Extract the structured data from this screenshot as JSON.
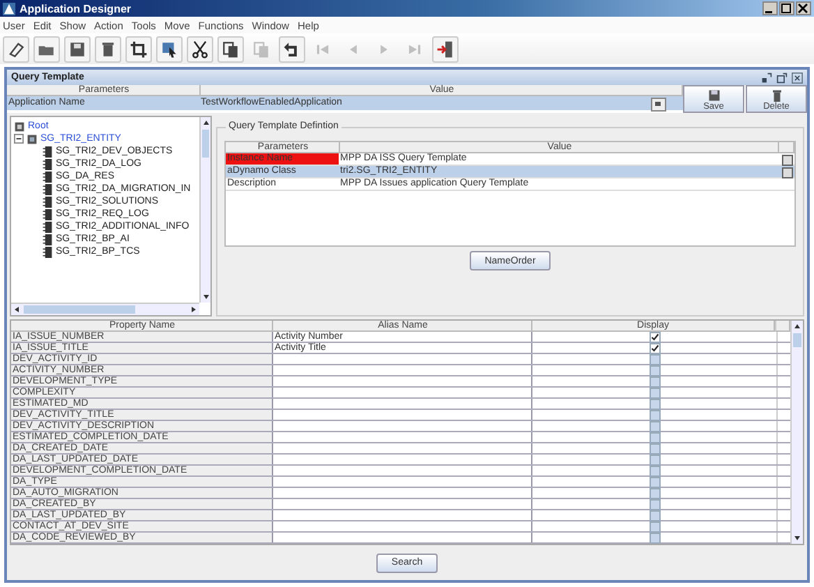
{
  "window": {
    "title": "Application Designer"
  },
  "menu": [
    "User",
    "Edit",
    "Show",
    "Action",
    "Tools",
    "Move",
    "Functions",
    "Window",
    "Help"
  ],
  "toolbar": [
    {
      "disabled": false
    },
    {
      "disabled": false
    },
    {
      "disabled": false
    },
    {
      "disabled": false
    },
    {
      "disabled": false
    },
    {
      "disabled": false
    },
    {
      "disabled": false
    },
    {
      "disabled": false
    },
    {
      "disabled": true
    },
    {
      "disabled": false
    },
    {
      "disabled": true
    },
    {
      "disabled": true
    },
    {
      "disabled": true
    },
    {
      "disabled": true
    },
    {
      "disabled": false
    }
  ],
  "panel": {
    "title": "Query Template"
  },
  "params_table": {
    "columns": [
      "Parameters",
      "Value"
    ],
    "rows": [
      {
        "name": "Application Name",
        "value": "TestWorkflowEnabledApplication",
        "selected": true
      }
    ]
  },
  "actions": [
    "Save",
    "Delete"
  ],
  "tree": {
    "label": "Root",
    "children": [
      {
        "label": "SG_TRI2_ENTITY",
        "expanded": true,
        "children": [
          {
            "label": "SG_TRI2_DEV_OBJECTS"
          },
          {
            "label": "SG_TRI2_DA_LOG"
          },
          {
            "label": "SG_DA_RES"
          },
          {
            "label": "SG_TRI2_DA_MIGRATION_IN"
          },
          {
            "label": "SG_TRI2_SOLUTIONS"
          },
          {
            "label": "SG_TRI2_REQ_LOG"
          },
          {
            "label": "SG_TRI2_ADDITIONAL_INFO"
          },
          {
            "label": "SG_TRI2_BP_AI"
          },
          {
            "label": "SG_TRI2_BP_TCS"
          }
        ]
      }
    ]
  },
  "definition": {
    "title": "Query Template Defintion",
    "columns": [
      "Parameters",
      "Value"
    ],
    "rows": [
      {
        "name": "Instance Name",
        "value": "MPP DA ISS Query Template",
        "invalid": true,
        "selected": false,
        "picker": true
      },
      {
        "name": "aDynamo Class",
        "value": "tri2.SG_TRI2_ENTITY",
        "invalid": false,
        "selected": true,
        "picker": true
      },
      {
        "name": "Description",
        "value": "MPP DA Issues application Query Template",
        "invalid": false,
        "selected": false,
        "picker": false
      }
    ],
    "button": "NameOrder"
  },
  "properties": {
    "columns": [
      "Property Name",
      "Alias Name",
      "Display"
    ],
    "rows": [
      {
        "property": "IA_ISSUE_NUMBER",
        "alias": "Activity Number",
        "display": true
      },
      {
        "property": "IA_ISSUE_TITLE",
        "alias": "Activity Title",
        "display": true
      },
      {
        "property": "DEV_ACTIVITY_ID",
        "display": false
      },
      {
        "property": "ACTIVITY_NUMBER",
        "display": false
      },
      {
        "property": "DEVELOPMENT_TYPE",
        "display": false
      },
      {
        "property": "COMPLEXITY",
        "display": false
      },
      {
        "property": "ESTIMATED_MD",
        "display": false
      },
      {
        "property": "DEV_ACTIVITY_TITLE",
        "display": false
      },
      {
        "property": "DEV_ACTIVITY_DESCRIPTION",
        "display": false
      },
      {
        "property": "ESTIMATED_COMPLETION_DATE",
        "display": false
      },
      {
        "property": "DA_CREATED_DATE",
        "display": false
      },
      {
        "property": "DA_LAST_UPDATED_DATE",
        "display": false
      },
      {
        "property": "DEVELOPMENT_COMPLETION_DATE",
        "display": false
      },
      {
        "property": "DA_TYPE",
        "display": false
      },
      {
        "property": "DA_AUTO_MIGRATION",
        "display": false
      },
      {
        "property": "DA_CREATED_BY",
        "display": false
      },
      {
        "property": "DA_LAST_UPDATED_BY",
        "display": false
      },
      {
        "property": "CONTACT_AT_DEV_SITE",
        "display": false
      },
      {
        "property": "DA_CODE_REVIEWED_BY",
        "display": false
      }
    ]
  },
  "search_button": "Search"
}
